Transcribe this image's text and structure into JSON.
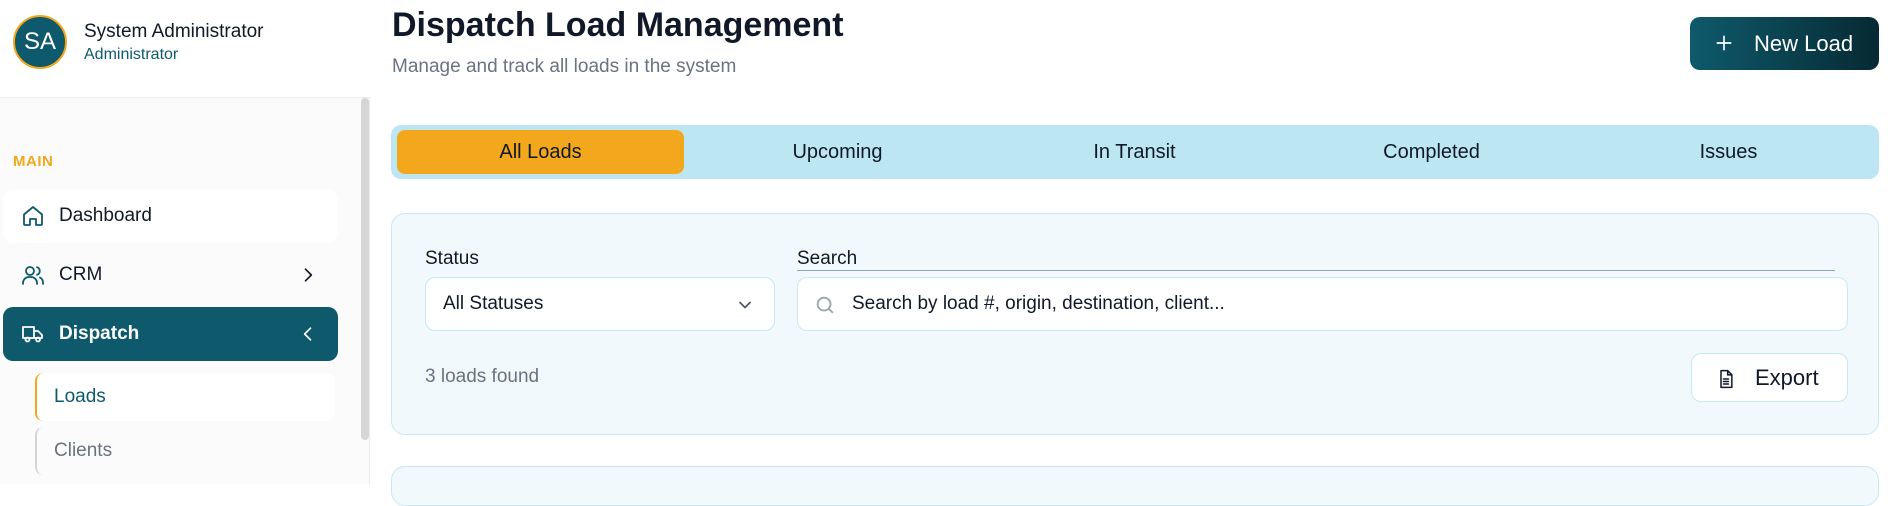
{
  "user": {
    "initials": "SA",
    "name": "System Administrator",
    "role": "Administrator"
  },
  "sidebar": {
    "section_label": "MAIN",
    "items": [
      {
        "label": "Dashboard",
        "icon": "home-icon"
      },
      {
        "label": "CRM",
        "icon": "users-icon"
      },
      {
        "label": "Dispatch",
        "icon": "truck-icon",
        "active": true
      }
    ],
    "sub_items": [
      {
        "label": "Loads",
        "active": true
      },
      {
        "label": "Clients"
      }
    ]
  },
  "header": {
    "title": "Dispatch Load Management",
    "subtitle": "Manage and track all loads in the system",
    "new_load_label": "New Load"
  },
  "tabs": [
    {
      "label": "All Loads",
      "active": true
    },
    {
      "label": "Upcoming"
    },
    {
      "label": "In Transit"
    },
    {
      "label": "Completed"
    },
    {
      "label": "Issues"
    }
  ],
  "filters": {
    "status_label": "Status",
    "status_value": "All Statuses",
    "search_label": "Search",
    "search_placeholder": "Search by load #, origin, destination, client...",
    "result_count": "3 loads found",
    "export_label": "Export"
  },
  "colors": {
    "primary": "#0e5a6c",
    "accent": "#f2a71c",
    "tabs_bg": "#bde6f3",
    "card_bg": "#f1f9fc"
  }
}
